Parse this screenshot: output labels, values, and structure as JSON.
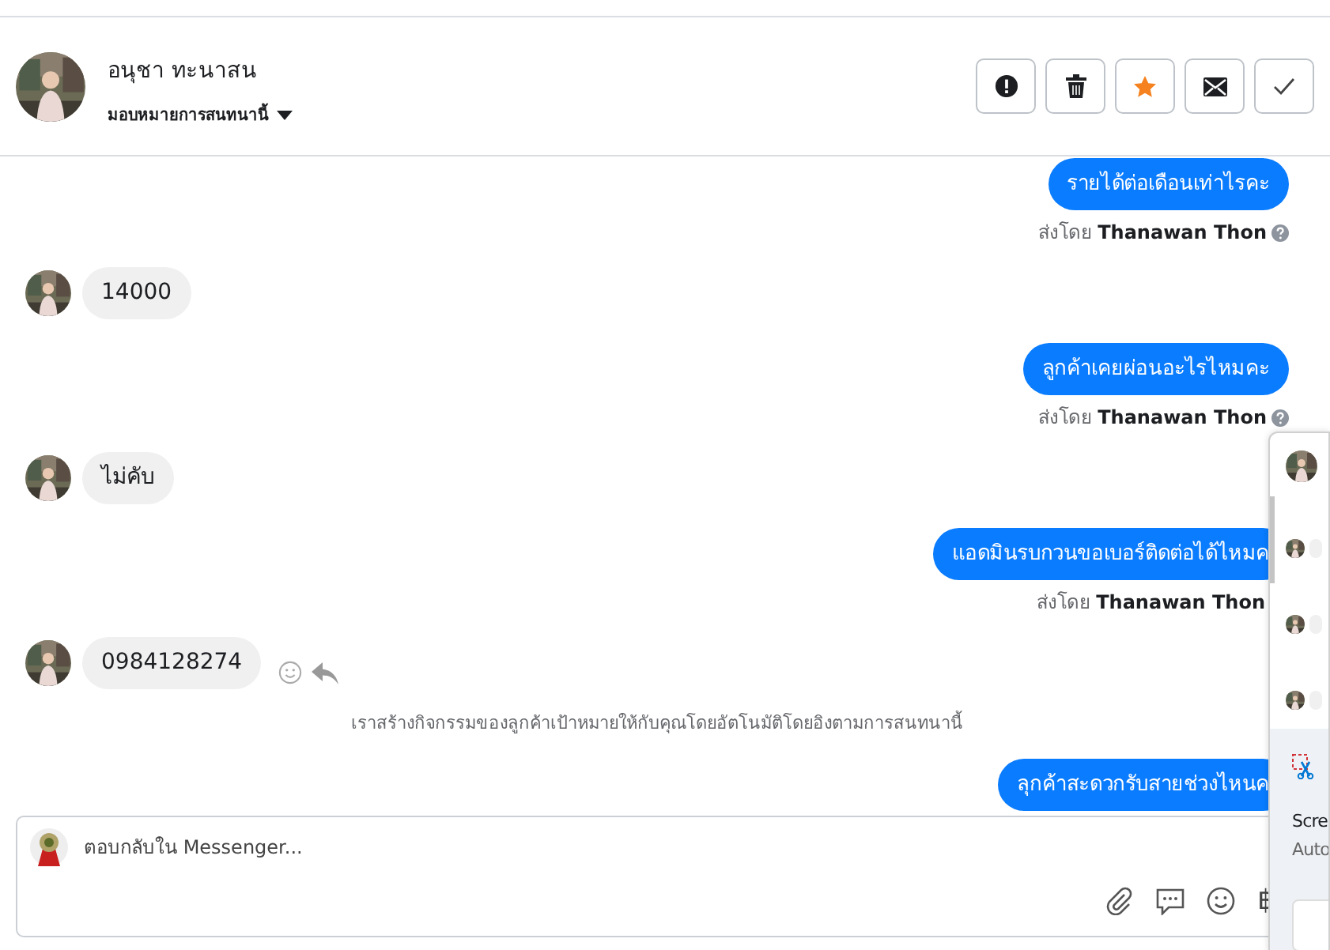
{
  "conversation": {
    "contact_name": "อนุชา ทะนาสน",
    "assign_label": "มอบหมายการสนทนานี้"
  },
  "actions": [
    {
      "kind": "spam",
      "on": false
    },
    {
      "kind": "delete",
      "on": false
    },
    {
      "kind": "star",
      "on": true
    },
    {
      "kind": "mail",
      "on": false
    },
    {
      "kind": "done",
      "on": false
    }
  ],
  "messages": [
    {
      "kind": "outgoing",
      "text": "รายได้ต่อเดือนเท่าไรคะ",
      "sender": "ส่งโดย **Thanawan Thon**",
      "help": true
    },
    {
      "kind": "incoming",
      "text": "14000",
      "reactions": false
    },
    {
      "kind": "outgoing",
      "text": "ลูกค้าเคยผ่อนอะไรไหมคะ",
      "sender": "ส่งโดย **Thanawan Thon**",
      "help": true
    },
    {
      "kind": "incoming",
      "text": "ไม่คับ",
      "reactions": false
    },
    {
      "kind": "outgoing",
      "text": "แอดมินรบกวนขอเบอร์ติดต่อได้ไหมค",
      "sender": "ส่งโดย **Thanawan Thon**",
      "help": false
    },
    {
      "kind": "incoming",
      "text": "0984128274",
      "reactions": true
    },
    {
      "kind": "system",
      "text": "เราสร้างกิจกรรมของลูกค้าเป้าหมายให้กับคุณโดยอัตโนมัติโดยอิงตามการสนทนานี้"
    },
    {
      "kind": "outgoing",
      "text": "ลุกค้าสะดวกรับสายช่วงไหนค"
    }
  ],
  "composer": {
    "placeholder": "ตอบกลับใน Messenger...",
    "currency": "฿"
  },
  "notification": {
    "title": "Scre",
    "subtitle": "Auto"
  }
}
